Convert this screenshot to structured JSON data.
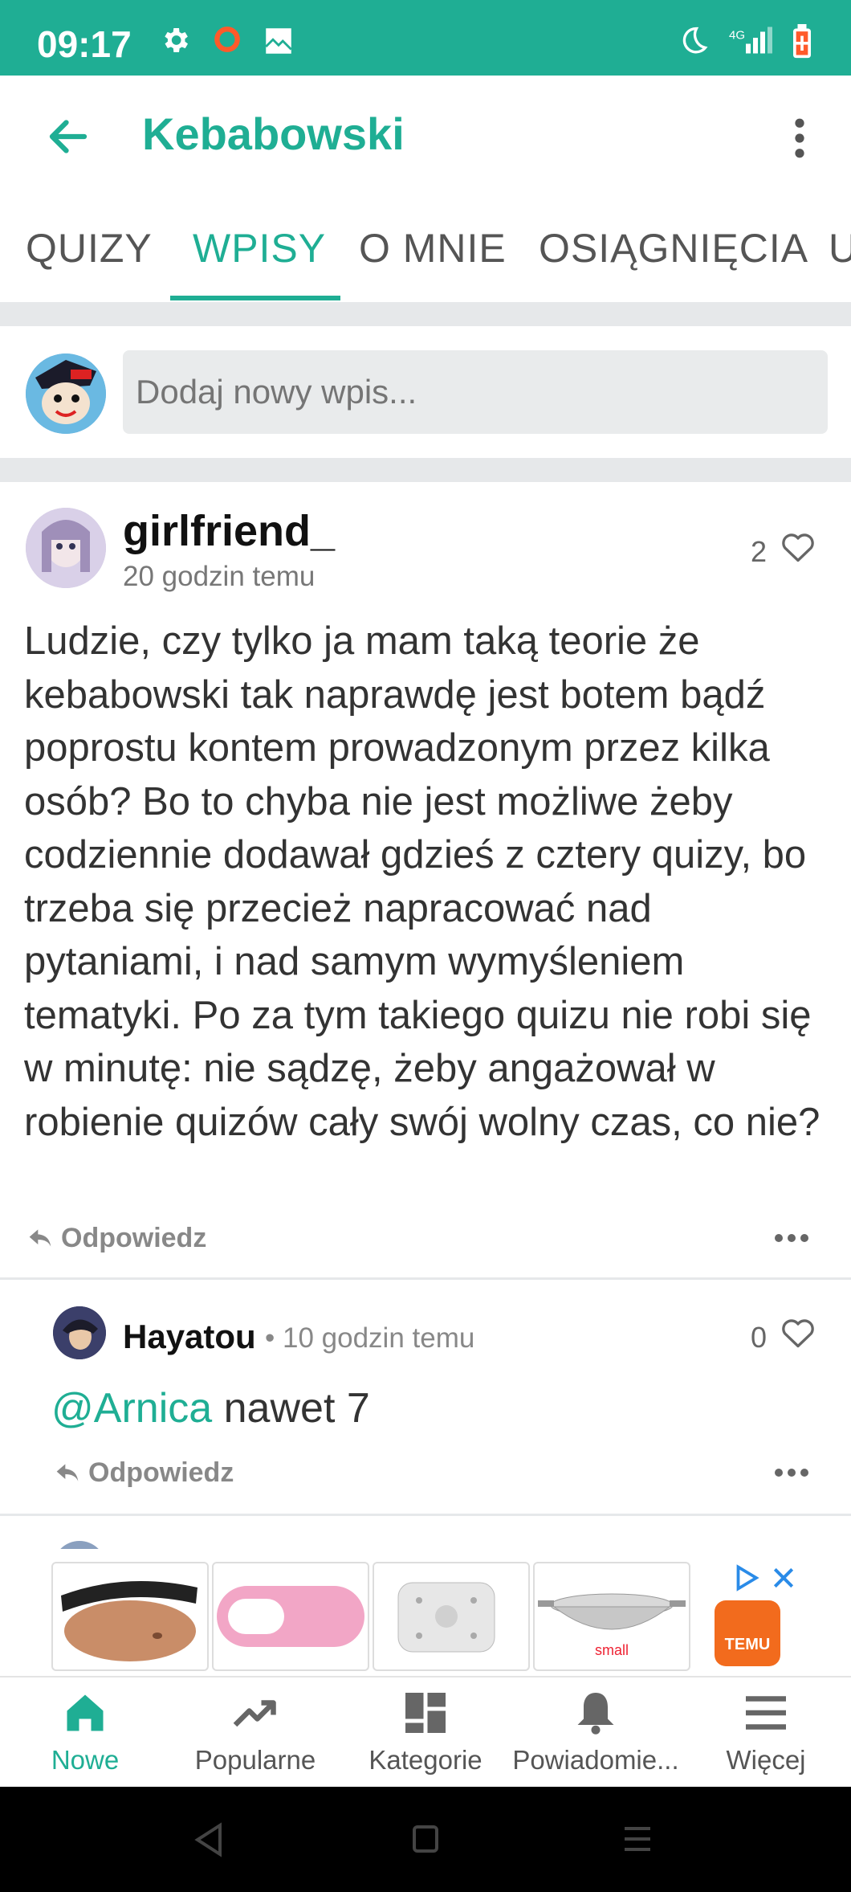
{
  "status_bar": {
    "time": "09:17",
    "icons": [
      "gear-icon",
      "record-icon",
      "photo-icon",
      "moon-icon",
      "signal-icon",
      "battery-icon"
    ],
    "network_label": "4G"
  },
  "app_bar": {
    "title": "Kebabowski",
    "accent_color": "#1fae94"
  },
  "tabs": [
    {
      "label": "QUIZY"
    },
    {
      "label": "WPISY",
      "active": true
    },
    {
      "label": "O MNIE"
    },
    {
      "label": "OSIĄGNIĘCIA"
    },
    {
      "label": "U"
    }
  ],
  "compose": {
    "placeholder": "Dodaj nowy wpis..."
  },
  "post": {
    "author": "girlfriend_",
    "time": "20 godzin temu",
    "likes": "2",
    "body": "Ludzie, czy tylko ja mam taką teorie że kebabowski tak naprawdę jest botem bądź poprostu kontem prowadzonym przez kilka osób? Bo to chyba nie jest możliwe żeby codziennie dodawał gdzieś z cztery quizy, bo trzeba się przecież napracować nad pytaniami, i nad samym wymyśleniem tematyki. Po za tym takiego quizu nie robi się w minutę: nie sądzę, żeby angażował w robienie quizów cały swój wolny czas, co nie?",
    "reply_label": "Odpowiedz"
  },
  "comment": {
    "author": "Hayatou",
    "separator": "•",
    "time": "10 godzin temu",
    "likes": "0",
    "mention": "@Arnica",
    "text": " nawet 7",
    "reply_label": "Odpowiedz"
  },
  "ad": {
    "tile_caption": "small",
    "brand": "TEMU",
    "brand_color": "#f26b1d"
  },
  "bottom_nav": [
    {
      "label": "Nowe",
      "icon": "home-icon",
      "active": true
    },
    {
      "label": "Popularne",
      "icon": "trending-icon"
    },
    {
      "label": "Kategorie",
      "icon": "grid-icon"
    },
    {
      "label": "Powiadomie...",
      "icon": "bell-icon"
    },
    {
      "label": "Więcej",
      "icon": "menu-lines-icon"
    }
  ]
}
